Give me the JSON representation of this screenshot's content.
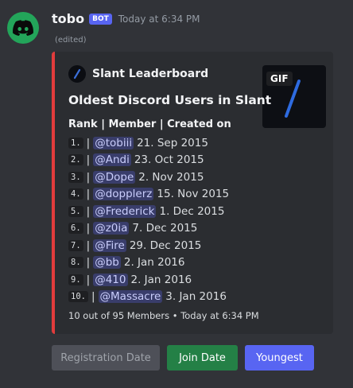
{
  "message": {
    "username": "tobo",
    "bot_tag": "BOT",
    "timestamp": "Today at 6:34 PM",
    "edited": "(edited)",
    "avatar_icon": "discord-logo-icon"
  },
  "embed": {
    "accent_color": "#e23c3c",
    "author": "Slant Leaderboard",
    "thumbnail_badge": "GIF",
    "title": "Oldest Discord Users in Slant",
    "subtitle": "Rank | Member | Created on",
    "rows": [
      {
        "rank": "1.",
        "member": "@tobiii",
        "date": "21. Sep 2015"
      },
      {
        "rank": "2.",
        "member": "@Andi",
        "date": "23. Oct 2015"
      },
      {
        "rank": "3.",
        "member": "@Dope",
        "date": "2. Nov 2015"
      },
      {
        "rank": "4.",
        "member": "@dopplerz",
        "date": "15. Nov 2015"
      },
      {
        "rank": "5.",
        "member": "@Frederick",
        "date": "1. Dec 2015"
      },
      {
        "rank": "6.",
        "member": "@z0ia",
        "date": "7. Dec 2015"
      },
      {
        "rank": "7.",
        "member": "@Fire",
        "date": "29. Dec 2015"
      },
      {
        "rank": "8.",
        "member": "@bb",
        "date": "2. Jan 2016"
      },
      {
        "rank": "9.",
        "member": "@410",
        "date": "2. Jan 2016"
      },
      {
        "rank": "10.",
        "member": "@Massacre",
        "date": "3. Jan 2016"
      }
    ],
    "footer": "10 out of 95 Members • Today at 6:34 PM"
  },
  "buttons": {
    "registration": "Registration Date",
    "join": "Join Date",
    "youngest": "Youngest"
  }
}
